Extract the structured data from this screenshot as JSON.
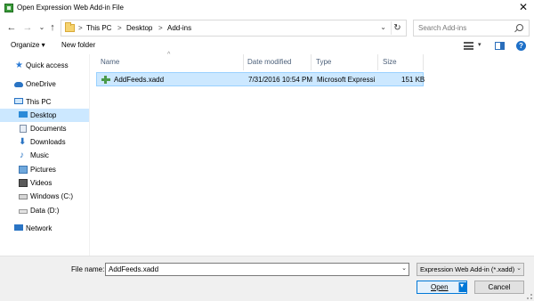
{
  "window": {
    "title": "Open Expression Web Add-in File",
    "close_glyph": "✕"
  },
  "nav": {
    "back_glyph": "←",
    "forward_glyph": "→",
    "recent_glyph": "⌄",
    "up_glyph": "↑",
    "breadcrumb": [
      "This PC",
      "Desktop",
      "Add-ins"
    ],
    "sep_glyph": ">",
    "dropdown_glyph": "⌄",
    "refresh_glyph": "↻",
    "search_placeholder": "Search Add-ins"
  },
  "toolbar": {
    "organize_label": "Organize ▾",
    "new_folder_label": "New folder",
    "view_dd_glyph": "▾",
    "help_glyph": "?"
  },
  "sidebar": {
    "items": [
      {
        "label": "Quick access",
        "icon": "star-icon"
      },
      {
        "label": "OneDrive",
        "icon": "cloud-icon"
      },
      {
        "label": "This PC",
        "icon": "computer-icon"
      },
      {
        "label": "Desktop",
        "icon": "desktop-icon",
        "selected": true
      },
      {
        "label": "Documents",
        "icon": "documents-icon"
      },
      {
        "label": "Downloads",
        "icon": "download-icon"
      },
      {
        "label": "Music",
        "icon": "music-icon"
      },
      {
        "label": "Pictures",
        "icon": "pictures-icon"
      },
      {
        "label": "Videos",
        "icon": "videos-icon"
      },
      {
        "label": "Windows (C:)",
        "icon": "drive-icon"
      },
      {
        "label": "Data (D:)",
        "icon": "drive-icon"
      },
      {
        "label": "Network",
        "icon": "network-icon"
      }
    ],
    "glyphs": {
      "star": "★",
      "download": "⬇",
      "music": "♪"
    }
  },
  "file_list": {
    "columns": [
      "Name",
      "Date modified",
      "Type",
      "Size"
    ],
    "sort_caret": "^",
    "rows": [
      {
        "name": "AddFeeds.xadd",
        "date": "7/31/2016 10:54 PM",
        "type": "Microsoft Expressi...",
        "size": "151 KB"
      }
    ]
  },
  "footer": {
    "file_name_label": "File name:",
    "file_name_value": "AddFeeds.xadd",
    "dropdown_glyph": "⌄",
    "filter_value": "Expression Web Add-in (*.xadd)",
    "open_label": "Open",
    "cancel_label": "Cancel"
  },
  "colors": {
    "selection": "#cce8ff",
    "accent": "#0078d7"
  }
}
